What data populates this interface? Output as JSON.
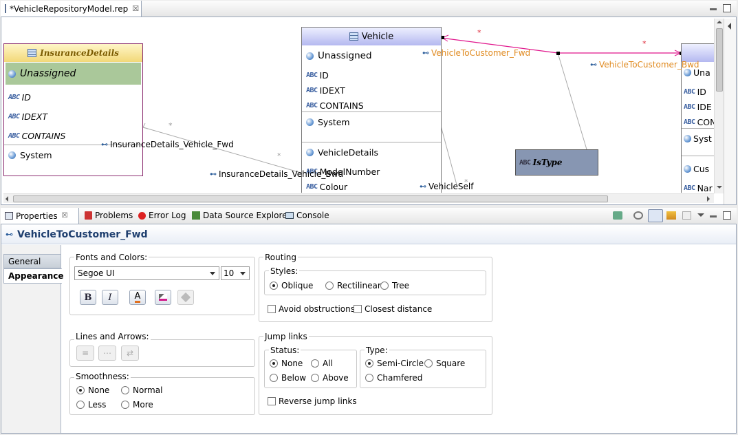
{
  "editor": {
    "tab_title": "*VehicleRepositoryModel.rep",
    "close_glyph": "☒"
  },
  "diagram": {
    "insurance": {
      "title": "InsuranceDetails",
      "unassigned": "Unassigned",
      "attrs": [
        "ID",
        "IDEXT",
        "CONTAINS"
      ],
      "system": "System"
    },
    "vehicle": {
      "title": "Vehicle",
      "unassigned": "Unassigned",
      "attrs": [
        "ID",
        "IDEXT",
        "CONTAINS"
      ],
      "system": "System",
      "more": [
        "VehicleDetails",
        "ModelNumber",
        "Colour"
      ]
    },
    "right_node": {
      "unassigned": "Una",
      "attrs": [
        "ID",
        "IDE",
        "CON"
      ],
      "system": "Syst",
      "more": [
        "Cus",
        "Nar"
      ]
    },
    "istype": "IsType",
    "edges": {
      "ins_fwd": "InsuranceDetails_Vehicle_Fwd",
      "ins_bwd": "InsuranceDetails_Vehicle_Bwd",
      "veh_cust_fwd": "VehicleToCustomer_Fwd",
      "veh_cust_bwd": "VehicleToCustomer_Bwd",
      "veh_self": "VehicleSelf"
    },
    "star": "*",
    "abc": "ABC"
  },
  "views": {
    "tabs": [
      "Properties",
      "Problems",
      "Error Log",
      "Data Source Explorer",
      "Console"
    ]
  },
  "properties": {
    "title": "VehicleToCustomer_Fwd",
    "side_tabs": [
      "General",
      "Appearance"
    ],
    "fonts_colors": "Fonts and Colors:",
    "font_name": "Segoe UI",
    "font_size": "10",
    "bold": "B",
    "italic": "I",
    "font_color": "A",
    "lines_arrows": "Lines and Arrows:",
    "smoothness": {
      "title": "Smoothness:",
      "options": [
        "None",
        "Normal",
        "Less",
        "More"
      ],
      "selected": "None"
    },
    "routing": {
      "title": "Routing",
      "styles_title": "Styles:",
      "styles": [
        "Oblique",
        "Rectilinear",
        "Tree"
      ],
      "selected": "Oblique",
      "avoid": "Avoid obstructions",
      "closest": "Closest distance"
    },
    "jump": {
      "title": "Jump links",
      "status_title": "Status:",
      "status": [
        "None",
        "All",
        "Below",
        "Above"
      ],
      "type_title": "Type:",
      "types": [
        "Semi-Circle",
        "Square",
        "Chamfered"
      ],
      "reverse": "Reverse jump links"
    }
  }
}
